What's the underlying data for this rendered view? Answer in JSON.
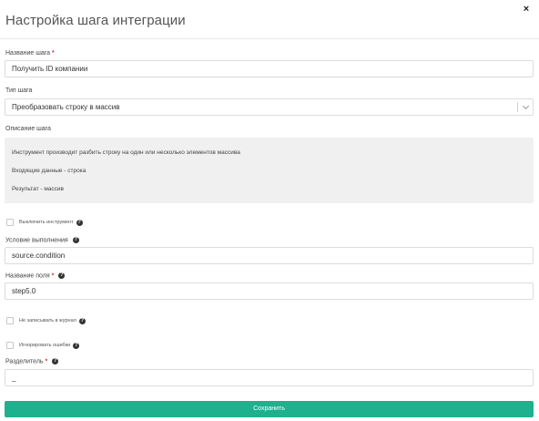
{
  "dialog": {
    "title": "Настройка шага интеграции",
    "close_glyph": "×"
  },
  "fields": {
    "step_name": {
      "label": "Название шага",
      "required": "*",
      "value": "Получить ID компании"
    },
    "step_type": {
      "label": "Тип шага",
      "value": "Преобразовать строку в массив"
    },
    "step_description": {
      "label": "Описание шага",
      "lines": [
        "Инструмент производит разбить строку на один или несколько элементов массива",
        "Входящие данные - строка",
        "Результат - массив"
      ]
    },
    "disable_tool": {
      "label": "Выключить инструмент",
      "checked": false
    },
    "condition": {
      "label": "Условие выполнения",
      "value": "source.condition"
    },
    "field_name": {
      "label": "Название поля",
      "required": "*",
      "value": "step5.0"
    },
    "no_log": {
      "label": "Не записывать в журнал",
      "checked": false
    },
    "ignore_errors": {
      "label": "Игнорировать ошибки",
      "checked": false
    },
    "separator": {
      "label": "Разделитель",
      "required": "*",
      "value": "_"
    }
  },
  "footer": {
    "save_label": "Сохранить"
  },
  "icons": {
    "help": "?",
    "close": "close-icon"
  },
  "colors": {
    "primary": "#1fb08e",
    "required": "#e3342f",
    "description_bg": "#f0f0f0"
  }
}
